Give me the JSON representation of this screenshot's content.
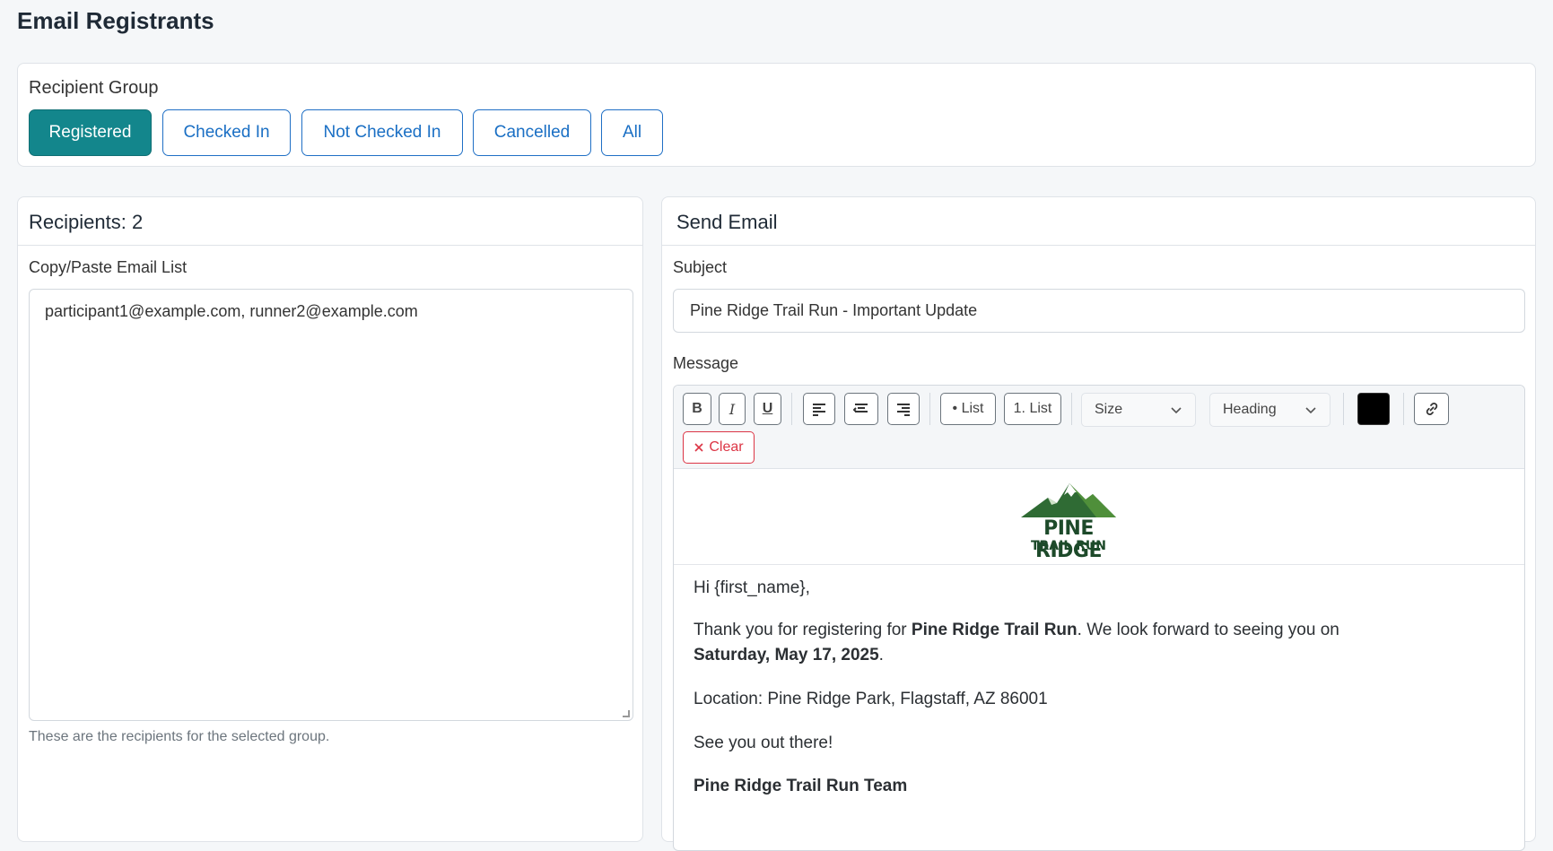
{
  "page_title": "Email Registrants",
  "recipient_group": {
    "label": "Recipient Group",
    "buttons": [
      "Registered",
      "Checked In",
      "Not Checked In",
      "Cancelled",
      "All"
    ],
    "active": "Registered"
  },
  "recipients": {
    "header": "Recipients: 2",
    "list_label": "Copy/Paste Email List",
    "emails": "participant1@example.com, runner2@example.com",
    "help": "These are the recipients for the selected group."
  },
  "send_email": {
    "header": "Send Email",
    "subject_label": "Subject",
    "subject": "Pine Ridge Trail Run - Important Update",
    "message_label": "Message",
    "toolbar": {
      "bold": "B",
      "italic": "I",
      "underline": "U",
      "bullet_list": "• List",
      "numbered_list": "1. List",
      "size": "Size",
      "heading": "Heading",
      "clear": "Clear",
      "text_color": "#000000"
    },
    "logo": {
      "line1": "PINE RIDGE",
      "line2": "TRAIL RUN"
    },
    "body": {
      "greeting": "Hi {first_name},",
      "p1_a": "Thank you for registering for ",
      "p1_event": "Pine Ridge Trail Run",
      "p1_b": ". We look forward to seeing you on",
      "p1_date": "Saturday, May 17, 2025",
      "p1_end": ".",
      "location": "Location: Pine Ridge Park, Flagstaff, AZ 86001",
      "closing": "See you out there!",
      "signature": "Pine Ridge Trail Run Team"
    }
  },
  "colors": {
    "accent": "#13868c",
    "link": "#1a6fc4",
    "danger": "#dc3545"
  }
}
